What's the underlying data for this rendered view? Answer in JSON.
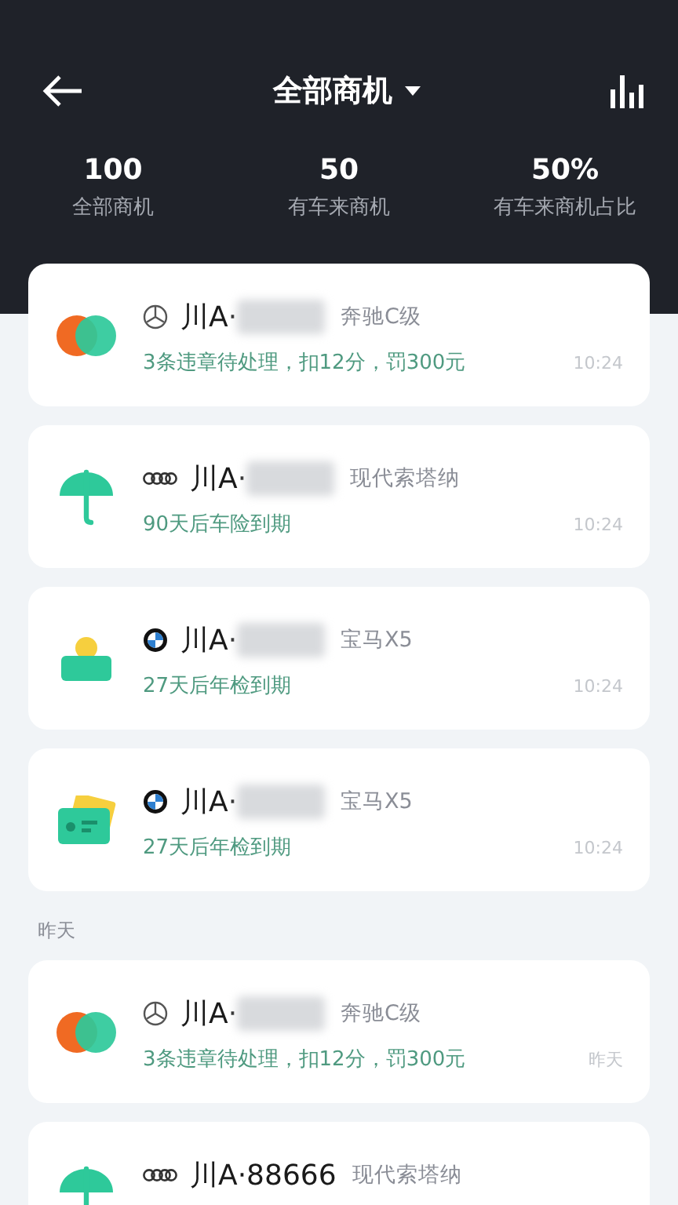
{
  "header": {
    "title": "全部商机",
    "stats": [
      {
        "value": "100",
        "label": "全部商机"
      },
      {
        "value": "50",
        "label": "有车来商机"
      },
      {
        "value": "50%",
        "label": "有车来商机占比"
      }
    ]
  },
  "groups": [
    {
      "cards": [
        {
          "kind": "violation",
          "brand": {
            "kind": "mercedes"
          },
          "plate": "川A·",
          "blurred": true,
          "model": "奔驰C级",
          "note": "3条违章待处理，扣12分，罚300元",
          "time": "10:24"
        },
        {
          "kind": "insurance",
          "brand": {
            "kind": "audi"
          },
          "plate": "川A·",
          "blurred": true,
          "model": "现代索塔纳",
          "note": "90天后车险到期",
          "time": "10:24"
        },
        {
          "kind": "inspection",
          "brand": {
            "kind": "bmw"
          },
          "plate": "川A·",
          "blurred": true,
          "model": "宝马X5",
          "note": "27天后年检到期",
          "time": "10:24"
        },
        {
          "kind": "license",
          "brand": {
            "kind": "bmw"
          },
          "plate": "川A·",
          "blurred": true,
          "model": "宝马X5",
          "note": "27天后年检到期",
          "time": "10:24"
        }
      ]
    },
    {
      "label": "昨天",
      "cards": [
        {
          "kind": "violation",
          "brand": {
            "kind": "mercedes"
          },
          "plate": "川A·",
          "blurred": true,
          "model": "奔驰C级",
          "note": "3条违章待处理，扣12分，罚300元",
          "time": "昨天"
        },
        {
          "kind": "insurance",
          "brand": {
            "kind": "audi"
          },
          "plate": "川A·88666",
          "blurred": false,
          "model": "现代索塔纳"
        }
      ]
    }
  ]
}
